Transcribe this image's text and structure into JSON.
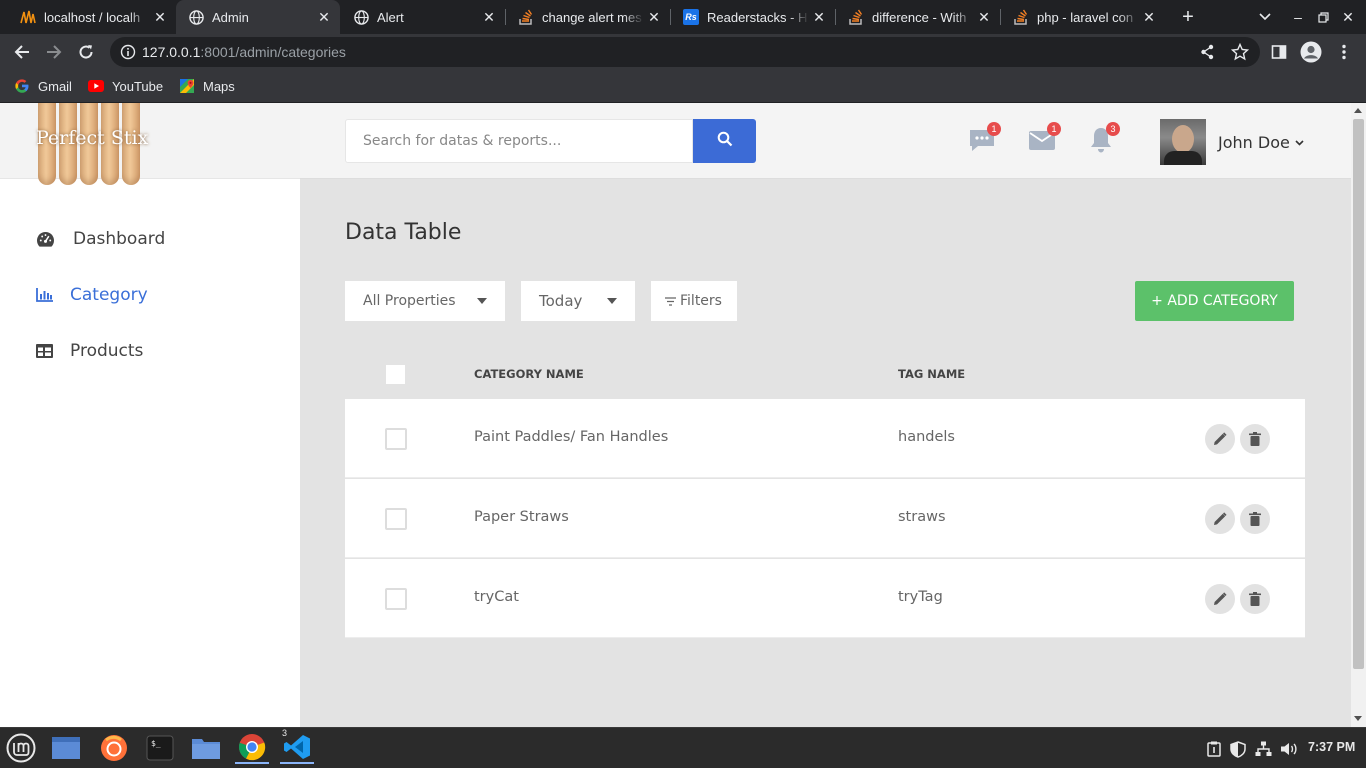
{
  "browser": {
    "tabs": [
      {
        "title": "localhost / localh",
        "icon": "phpmyadmin-icon",
        "active": false
      },
      {
        "title": "Admin",
        "icon": "globe-icon",
        "active": true
      },
      {
        "title": "Alert",
        "icon": "globe-icon",
        "active": false
      },
      {
        "title": "change alert mes",
        "icon": "stackoverflow-icon",
        "active": false
      },
      {
        "title": "Readerstacks - H",
        "icon": "readerstacks-icon",
        "active": false
      },
      {
        "title": "difference - With",
        "icon": "stackoverflow-icon",
        "active": false
      },
      {
        "title": "php - laravel con",
        "icon": "stackoverflow-icon",
        "active": false
      }
    ],
    "url_host": "127.0.0.1",
    "url_rest": ":8001/admin/categories",
    "bookmarks": [
      {
        "label": "Gmail",
        "icon": "google-icon"
      },
      {
        "label": "YouTube",
        "icon": "youtube-icon"
      },
      {
        "label": "Maps",
        "icon": "maps-icon"
      }
    ]
  },
  "sidebar": {
    "logo_text": "Perfect Stix",
    "items": [
      {
        "label": "Dashboard",
        "icon": "dashboard-icon",
        "active": false
      },
      {
        "label": "Category",
        "icon": "bar-chart-icon",
        "active": true
      },
      {
        "label": "Products",
        "icon": "table-icon",
        "active": false
      }
    ]
  },
  "header": {
    "search_placeholder": "Search for datas & reports...",
    "badges": {
      "messages": "1",
      "mail": "1",
      "notifications": "3"
    },
    "user_name": "John Doe"
  },
  "main": {
    "title": "Data Table",
    "filters": {
      "property": "All Properties",
      "period": "Today",
      "filters_label": "Filters"
    },
    "add_button": "+ ADD CATEGORY",
    "columns": [
      "CATEGORY NAME",
      "TAG NAME"
    ],
    "rows": [
      {
        "category": "Paint Paddles/ Fan Handles",
        "tag": "handels"
      },
      {
        "category": "Paper Straws",
        "tag": "straws"
      },
      {
        "category": "tryCat",
        "tag": "tryTag"
      }
    ]
  },
  "taskbar": {
    "vscode_badge": "3",
    "clock": "7:37 PM"
  },
  "colors": {
    "accent": "#3c6bd6",
    "add_button": "#5cc16a",
    "badge": "#e74c4c",
    "sidebar_active": "#3a6fd8"
  }
}
